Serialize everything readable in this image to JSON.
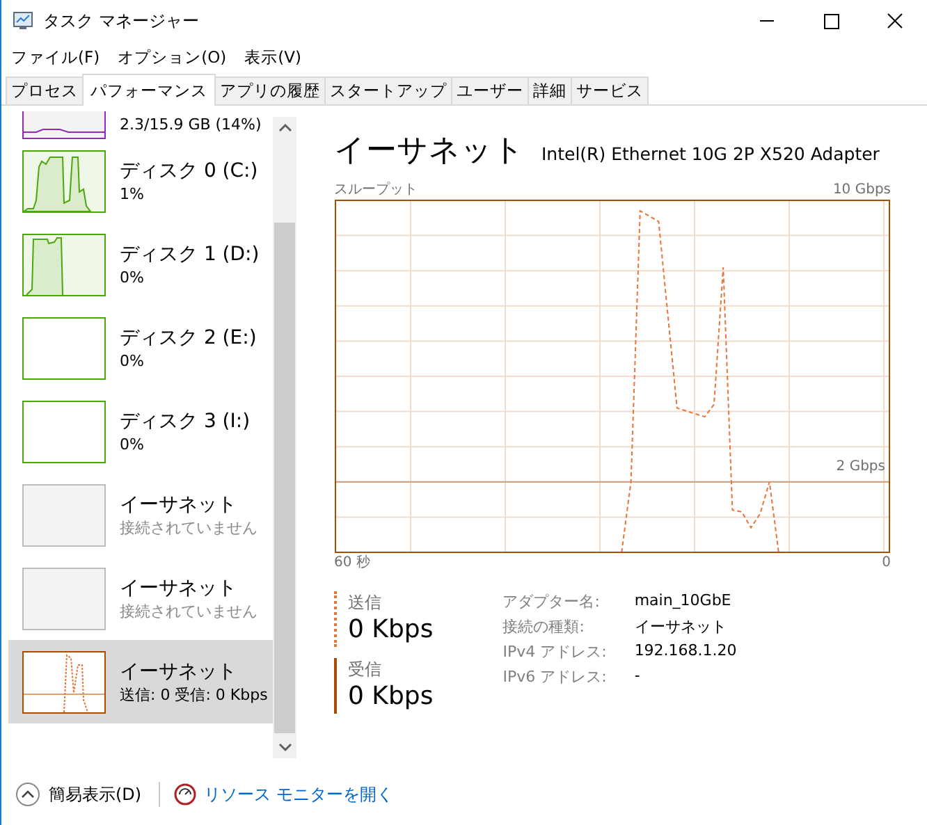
{
  "window": {
    "title": "タスク マネージャー"
  },
  "menu": [
    "ファイル(F)",
    "オプション(O)",
    "表示(V)"
  ],
  "tabs": [
    {
      "label": "プロセス",
      "selected": false
    },
    {
      "label": "パフォーマンス",
      "selected": true
    },
    {
      "label": "アプリの履歴",
      "selected": false
    },
    {
      "label": "スタートアップ",
      "selected": false
    },
    {
      "label": "ユーザー",
      "selected": false
    },
    {
      "label": "詳細",
      "selected": false
    },
    {
      "label": "サービス",
      "selected": false
    }
  ],
  "sidebar": {
    "items": [
      {
        "kind": "memory",
        "subtitle": "2.3/15.9 GB (14%)",
        "selected": false
      },
      {
        "kind": "disk-busy",
        "title": "ディスク 0 (C:)",
        "subtitle": "1%",
        "selected": false
      },
      {
        "kind": "disk-block",
        "title": "ディスク 1 (D:)",
        "subtitle": "0%",
        "selected": false
      },
      {
        "kind": "disk",
        "title": "ディスク 2 (E:)",
        "subtitle": "0%",
        "selected": false
      },
      {
        "kind": "disk",
        "title": "ディスク 3 (I:)",
        "subtitle": "0%",
        "selected": false
      },
      {
        "kind": "ethernet-off",
        "title": "イーサネット",
        "subtitle": "接続されていません",
        "selected": false
      },
      {
        "kind": "ethernet-off",
        "title": "イーサネット",
        "subtitle": "接続されていません",
        "selected": false
      },
      {
        "kind": "ethernet",
        "title": "イーサネット",
        "subtitle": "送信: 0 受信: 0 Kbps",
        "selected": true
      }
    ]
  },
  "main": {
    "title": "イーサネット",
    "adapter": "Intel(R) Ethernet 10G 2P X520 Adapter",
    "graph": {
      "title": "スループット",
      "top_label": "10 Gbps",
      "scale_label": "2 Gbps",
      "left_label": "60 秒",
      "right_label": "0"
    },
    "rates": [
      {
        "kind": "send",
        "label": "送信",
        "value": "0 Kbps"
      },
      {
        "kind": "receive",
        "label": "受信",
        "value": "0 Kbps"
      }
    ],
    "details": [
      {
        "label": "アダプター名:",
        "value": "main_10GbE"
      },
      {
        "label": "接続の種類:",
        "value": "イーサネット"
      },
      {
        "label": "IPv4 アドレス:",
        "value": "192.168.1.20"
      },
      {
        "label": "IPv6 アドレス:",
        "value": "-"
      }
    ]
  },
  "footer": {
    "fewer_details": "簡易表示(D)",
    "resource_monitor": "リソース モニターを開く"
  }
}
